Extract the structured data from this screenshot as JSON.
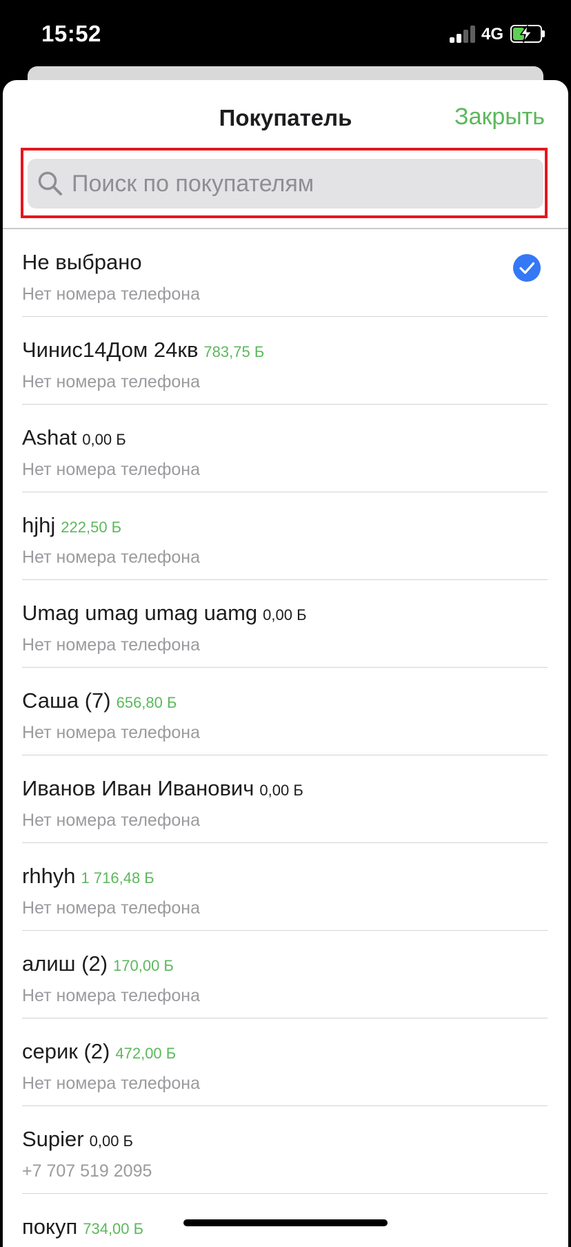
{
  "status_bar": {
    "time": "15:52",
    "network": "4G"
  },
  "header": {
    "title": "Покупатель",
    "close_label": "Закрыть"
  },
  "search": {
    "placeholder": "Поиск по покупателям",
    "value": ""
  },
  "colors": {
    "accent": "#5cb85c",
    "check": "#3478f6",
    "highlight_border": "#e4161e"
  },
  "customers": [
    {
      "name": "Не выбрано",
      "balance": "",
      "balance_color": "",
      "phone": "Нет номера телефона",
      "selected": true
    },
    {
      "name": "Чинис14Дом 24кв",
      "balance": "783,75 Б",
      "balance_color": "green",
      "phone": "Нет номера телефона",
      "selected": false
    },
    {
      "name": "Ashat",
      "balance": "0,00 Б",
      "balance_color": "dark",
      "phone": "Нет номера телефона",
      "selected": false
    },
    {
      "name": "hjhj",
      "balance": "222,50 Б",
      "balance_color": "green",
      "phone": "Нет номера телефона",
      "selected": false
    },
    {
      "name": "Umag umag umag uamg",
      "balance": "0,00 Б",
      "balance_color": "dark",
      "phone": "Нет номера телефона",
      "selected": false
    },
    {
      "name": "Саша (7)",
      "balance": "656,80 Б",
      "balance_color": "green",
      "phone": "Нет номера телефона",
      "selected": false
    },
    {
      "name": "Иванов Иван Иванович",
      "balance": "0,00 Б",
      "balance_color": "dark",
      "phone": "Нет номера телефона",
      "selected": false
    },
    {
      "name": "rhhyh",
      "balance": "1 716,48 Б",
      "balance_color": "green",
      "phone": "Нет номера телефона",
      "selected": false
    },
    {
      "name": "алиш (2)",
      "balance": "170,00 Б",
      "balance_color": "green",
      "phone": "Нет номера телефона",
      "selected": false
    },
    {
      "name": "серик (2)",
      "balance": "472,00 Б",
      "balance_color": "green",
      "phone": "Нет номера телефона",
      "selected": false
    },
    {
      "name": "Supier",
      "balance": "0,00 Б",
      "balance_color": "dark",
      "phone": "+7 707 519 2095",
      "selected": false
    },
    {
      "name": "покуп",
      "balance": "734,00 Б",
      "balance_color": "green",
      "phone": "",
      "selected": false
    }
  ]
}
